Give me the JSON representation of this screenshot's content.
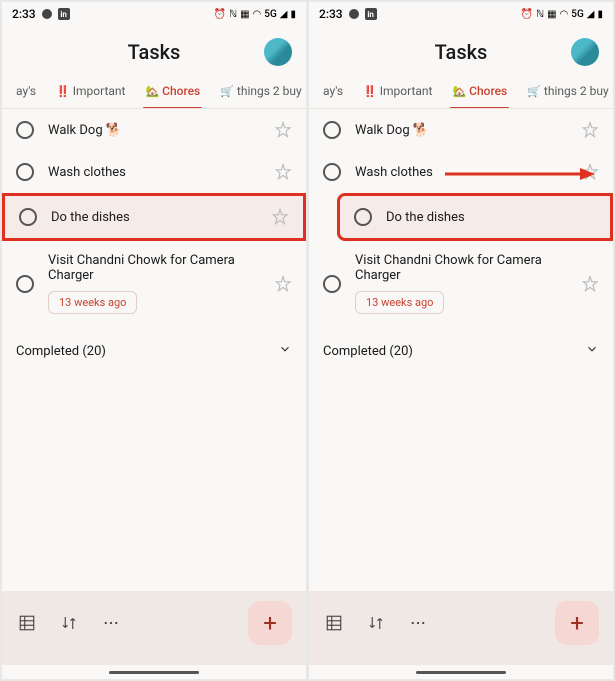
{
  "status": {
    "time": "2:33",
    "linkedin": "in"
  },
  "header": {
    "title": "Tasks"
  },
  "tabs": {
    "partial": "ay's",
    "important": "Important",
    "chores": "Chores",
    "shopping": "things 2 buy"
  },
  "tasks": {
    "walk_dog": "Walk Dog 🐕",
    "wash_clothes": "Wash clothes",
    "dishes": "Do the dishes",
    "visit": "Visit Chandni Chowk for Camera Charger",
    "visit_date": "13 weeks ago"
  },
  "completed": {
    "label": "Completed (20)"
  }
}
